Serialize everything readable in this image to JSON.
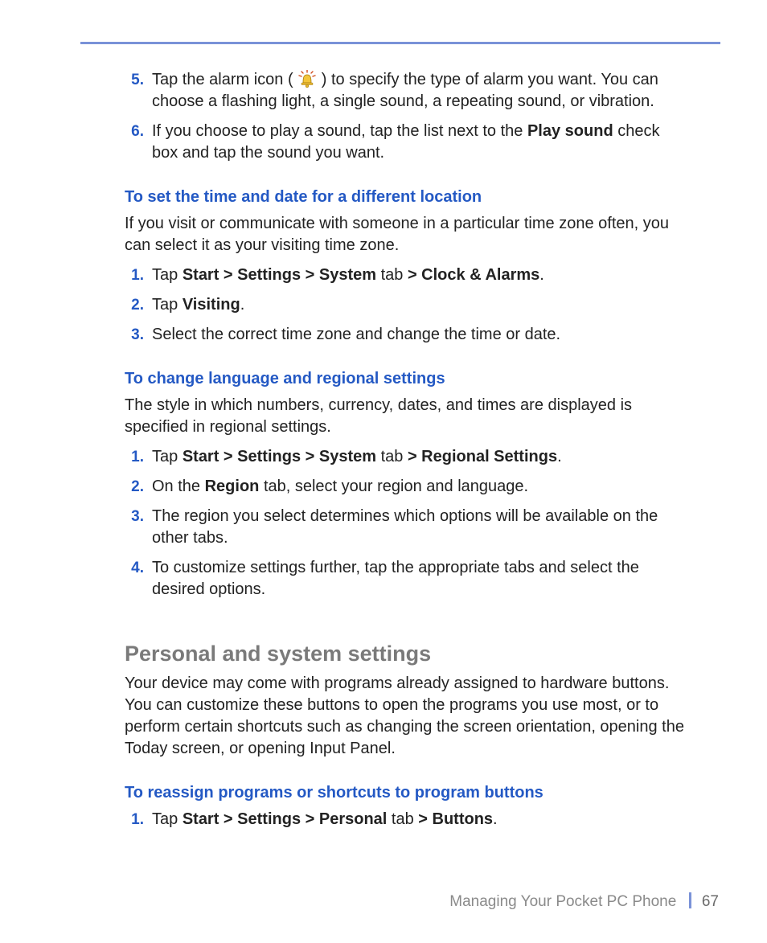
{
  "list1": {
    "items": [
      {
        "num": "5.",
        "pre": "Tap the alarm icon ( ",
        "post": " ) to specify the type of alarm you want. You can choose a flashing light, a single sound, a repeating sound, or vibration."
      },
      {
        "num": "6.",
        "text_a": "If you choose to play a sound, tap the list next to the ",
        "bold_a": "Play sound",
        "text_b": " check box and tap the sound you want."
      }
    ]
  },
  "sec1": {
    "heading": "To set the time and date for a different location",
    "para": "If you visit or communicate with someone in a particular time zone often, you can select it as your visiting time zone.",
    "items": [
      {
        "num": "1.",
        "t1": "Tap ",
        "b1": "Start > Settings > System",
        "t2": " tab ",
        "b2": "> Clock & Alarms",
        "t3": "."
      },
      {
        "num": "2.",
        "t1": "Tap ",
        "b1": "Visiting",
        "t2": "."
      },
      {
        "num": "3.",
        "t1": "Select the correct time zone and change the time or date."
      }
    ]
  },
  "sec2": {
    "heading": "To change language and regional settings",
    "para": "The style in which numbers, currency, dates, and times are displayed is specified in regional settings.",
    "items": [
      {
        "num": "1.",
        "t1": "Tap ",
        "b1": "Start > Settings > System",
        "t2": " tab ",
        "b2": "> Regional Settings",
        "t3": "."
      },
      {
        "num": "2.",
        "t1": "On the ",
        "b1": "Region",
        "t2": " tab, select your region and language."
      },
      {
        "num": "3.",
        "t1": "The region you select determines which options will be available on the other tabs."
      },
      {
        "num": "4.",
        "t1": "To customize settings further, tap the appropriate tabs and select the desired options."
      }
    ]
  },
  "sec3": {
    "title": "Personal and system settings",
    "para": "Your device may come with programs already assigned to hardware buttons. You can customize these buttons to open the programs you use most, or to perform certain shortcuts such as changing the screen orientation, opening the Today screen, or opening Input Panel.",
    "heading": "To reassign programs or shortcuts to program buttons",
    "items": [
      {
        "num": "1.",
        "t1": "Tap ",
        "b1": "Start > Settings > Personal",
        "t2": " tab ",
        "b2": "> Buttons",
        "t3": "."
      }
    ]
  },
  "footer": {
    "chapter": "Managing Your Pocket PC Phone",
    "page": "67"
  }
}
